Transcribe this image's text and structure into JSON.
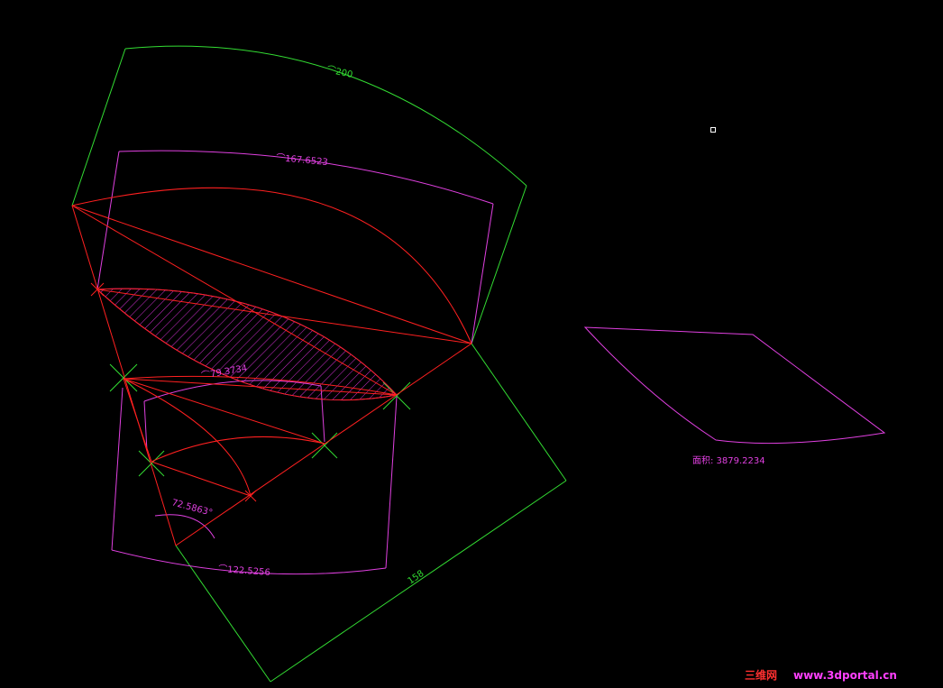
{
  "dimensions": {
    "outer_arc": "⌒200",
    "upper_arc": "⌒167.6523",
    "small_arc": "⌒79.3734",
    "angle": "72.5863°",
    "lower_arc": "⌒122.5256",
    "length": "158"
  },
  "area_label": "面积: 3879.2234",
  "watermark": {
    "cn": "三维网",
    "url": "www.3dportal.cn"
  },
  "colors": {
    "background": "#000000",
    "green": "#33dd33",
    "magenta": "#e040e0",
    "red": "#ff2020",
    "hatch": "#d030d0",
    "white": "#ffffff",
    "watermark_cn": "#ff3030",
    "watermark_url": "#ff40ff"
  }
}
